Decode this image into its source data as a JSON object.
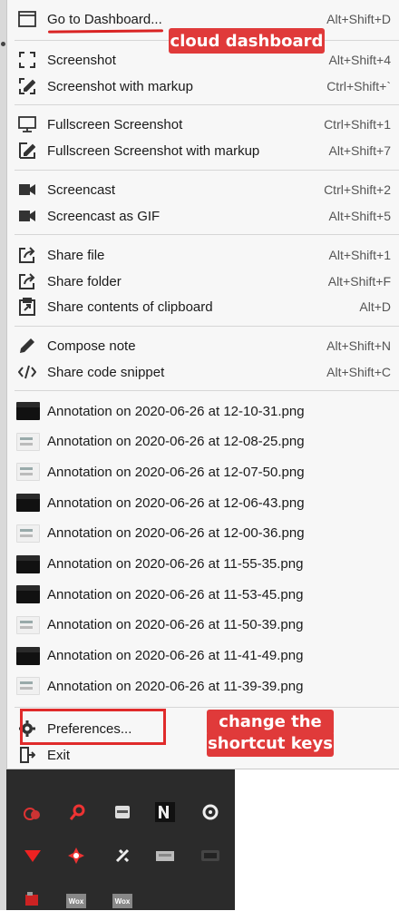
{
  "menu": {
    "go_to_dashboard": {
      "label": "Go to Dashboard...",
      "shortcut": "Alt+Shift+D"
    },
    "capture_items": [
      {
        "label": "Screenshot",
        "shortcut": "Alt+Shift+4",
        "icon": "screenshot-icon"
      },
      {
        "label": "Screenshot with markup",
        "shortcut": "Ctrl+Shift+`",
        "icon": "markup-icon"
      }
    ],
    "fullscreen_items": [
      {
        "label": "Fullscreen Screenshot",
        "shortcut": "Ctrl+Shift+1",
        "icon": "monitor-icon"
      },
      {
        "label": "Fullscreen Screenshot with markup",
        "shortcut": "Alt+Shift+7",
        "icon": "markup-icon"
      }
    ],
    "screencast_items": [
      {
        "label": "Screencast",
        "shortcut": "Ctrl+Shift+2",
        "icon": "video-camera-icon"
      },
      {
        "label": "Screencast as GIF",
        "shortcut": "Alt+Shift+5",
        "icon": "video-camera-icon"
      }
    ],
    "share_items": [
      {
        "label": "Share file",
        "shortcut": "Alt+Shift+1",
        "icon": "share-icon"
      },
      {
        "label": "Share folder",
        "shortcut": "Alt+Shift+F",
        "icon": "share-icon"
      },
      {
        "label": "Share contents of clipboard",
        "shortcut": "Alt+D",
        "icon": "clipboard-icon"
      }
    ],
    "note_items": [
      {
        "label": "Compose note",
        "shortcut": "Alt+Shift+N",
        "icon": "pencil-icon"
      },
      {
        "label": "Share code snippet",
        "shortcut": "Alt+Shift+C",
        "icon": "code-icon"
      }
    ],
    "recent_files": [
      {
        "label": "Annotation on 2020-06-26 at 12-10-31.png",
        "thumb": "dark"
      },
      {
        "label": "Annotation on 2020-06-26 at 12-08-25.png",
        "thumb": "light"
      },
      {
        "label": "Annotation on 2020-06-26 at 12-07-50.png",
        "thumb": "light"
      },
      {
        "label": "Annotation on 2020-06-26 at 12-06-43.png",
        "thumb": "dark"
      },
      {
        "label": "Annotation on 2020-06-26 at 12-00-36.png",
        "thumb": "light"
      },
      {
        "label": "Annotation on 2020-06-26 at 11-55-35.png",
        "thumb": "dark"
      },
      {
        "label": "Annotation on 2020-06-26 at 11-53-45.png",
        "thumb": "dark"
      },
      {
        "label": "Annotation on 2020-06-26 at 11-50-39.png",
        "thumb": "light"
      },
      {
        "label": "Annotation on 2020-06-26 at 11-41-49.png",
        "thumb": "dark"
      },
      {
        "label": "Annotation on 2020-06-26 at 11-39-39.png",
        "thumb": "light"
      }
    ],
    "preferences": {
      "label": "Preferences..."
    },
    "exit": {
      "label": "Exit"
    }
  },
  "annotations": {
    "dashboard_tag": "cloud dashboard",
    "shortcut_note_line1": "change the",
    "shortcut_note_line2": "shortcut keys"
  },
  "tray": {
    "wox_label": "Wox"
  },
  "colors": {
    "menu_bg": "#f7f7f7",
    "annotation_red": "#e03a3a",
    "tray_bg": "#2b2b2b"
  }
}
